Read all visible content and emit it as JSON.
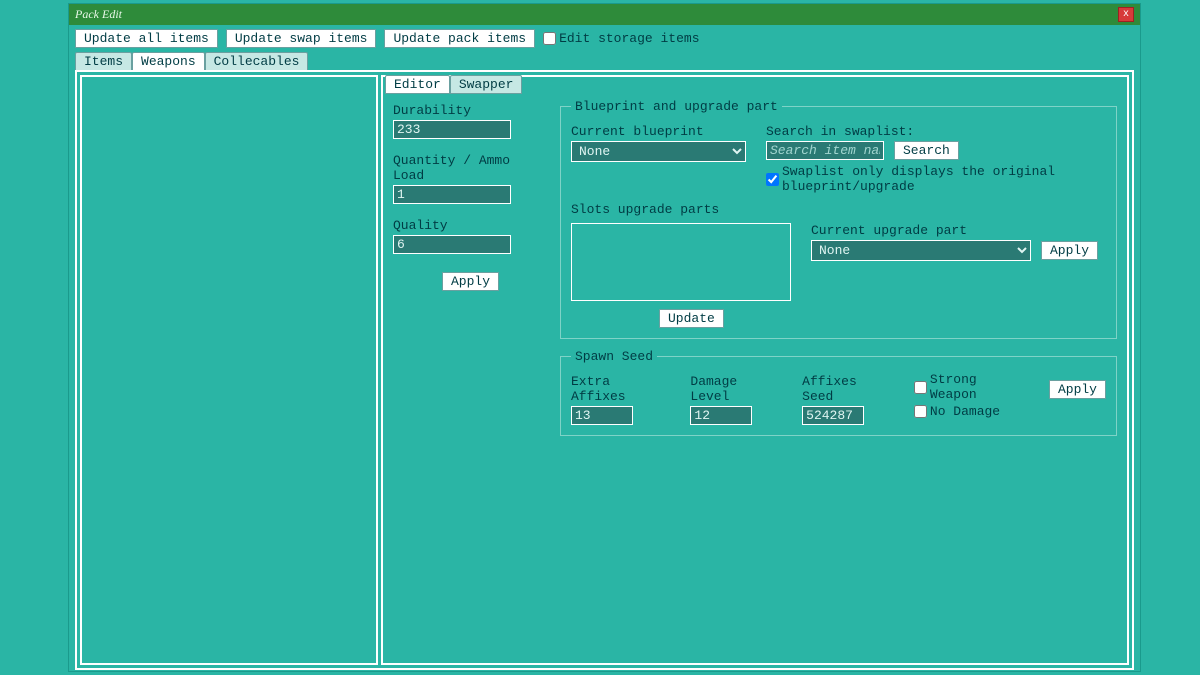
{
  "window": {
    "title": "Pack Edit"
  },
  "toolbar": {
    "update_all": "Update all items",
    "update_swap": "Update swap items",
    "update_pack": "Update pack items",
    "edit_storage": "Edit storage items"
  },
  "tabs": {
    "items": "Items",
    "weapons": "Weapons",
    "collecables": "Collecables"
  },
  "subtabs": {
    "editor": "Editor",
    "swapper": "Swapper"
  },
  "editor": {
    "durability_label": "Durability",
    "durability": "233",
    "quantity_label": "Quantity / Ammo Load",
    "quantity": "1",
    "quality_label": "Quality",
    "quality": "6",
    "apply": "Apply"
  },
  "blueprint": {
    "legend": "Blueprint and upgrade part",
    "current_label": "Current blueprint",
    "current": "None",
    "search_label": "Search in swaplist:",
    "search_placeholder": "Search item name",
    "search_btn": "Search",
    "swaplist_only": "Swaplist only displays the original blueprint/upgrade",
    "slots_label": "Slots upgrade parts",
    "cur_upgrade_label": "Current upgrade part",
    "cur_upgrade": "None",
    "apply": "Apply",
    "update": "Update"
  },
  "seed": {
    "legend": "Spawn Seed",
    "extra_affixes_label": "Extra Affixes",
    "extra_affixes": "13",
    "damage_level_label": "Damage Level",
    "damage_level": "12",
    "affixes_seed_label": "Affixes Seed",
    "affixes_seed": "524287",
    "strong_weapon": "Strong Weapon",
    "no_damage": "No Damage",
    "apply": "Apply"
  }
}
